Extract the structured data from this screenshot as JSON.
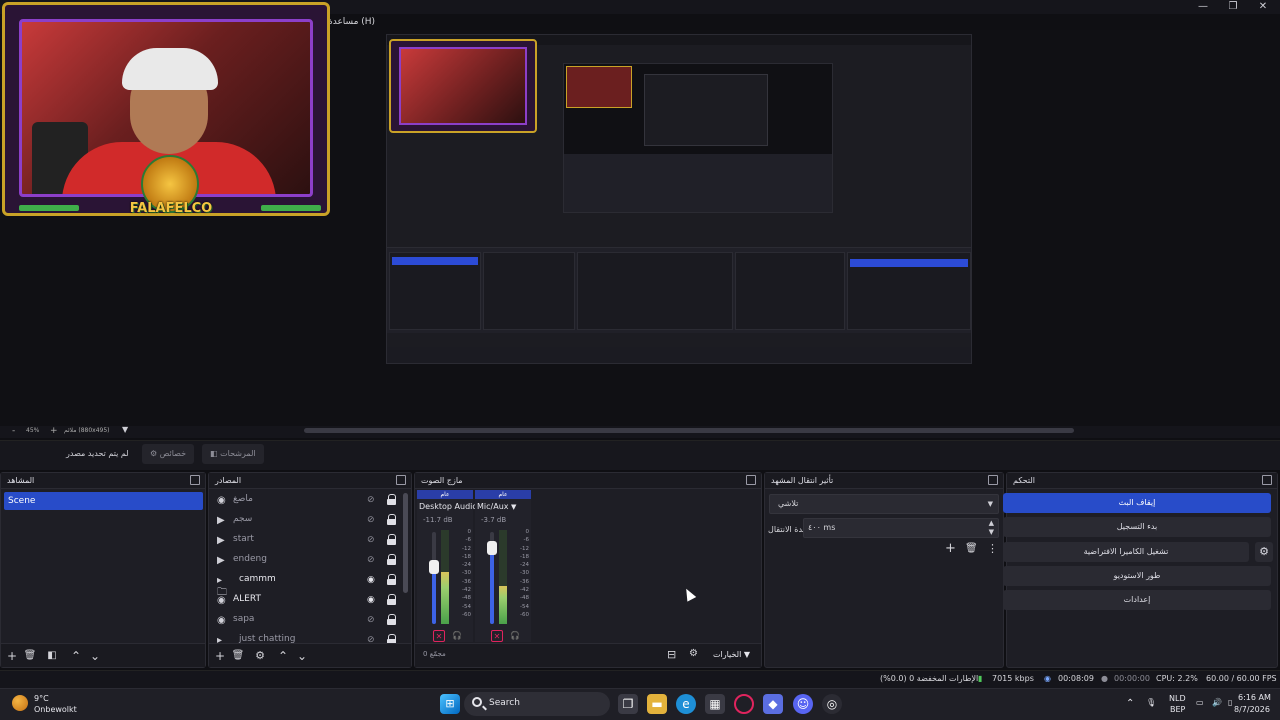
{
  "window": {
    "help_menu": "مساعدة (H)",
    "minimize": "—",
    "maximize": "❐",
    "close": "✕"
  },
  "camera_overlay": {
    "logo_text": "FALAFELCO"
  },
  "preview_toolbar": {
    "zoom_minus": "-",
    "zoom_level": "45%",
    "zoom_plus": "+",
    "canvas_size": "ملائم (880x495)",
    "zoom_dropdown": "▼"
  },
  "context_bar": {
    "no_source": "لم يتم تحديد مصدر",
    "properties": "خصائص",
    "filters": "المرشحات"
  },
  "docks": {
    "scenes": {
      "title": "المشاهد",
      "items": [
        "Scene"
      ]
    },
    "sources": {
      "title": "المصادر",
      "items": [
        {
          "label": "ماصغ",
          "icon": "◉",
          "active": false,
          "visible": false
        },
        {
          "label": "سجم",
          "icon": "▶",
          "active": false,
          "visible": false
        },
        {
          "label": "start",
          "icon": "▶",
          "active": false,
          "visible": false
        },
        {
          "label": "endeng",
          "icon": "▶",
          "active": false,
          "visible": false
        },
        {
          "label": "cammm",
          "icon": "▸",
          "active": true,
          "visible": true
        },
        {
          "label": "ALERT",
          "icon": "◉",
          "active": true,
          "visible": true
        },
        {
          "label": "sapa",
          "icon": "◉",
          "active": false,
          "visible": false
        },
        {
          "label": "just chatting",
          "icon": "▸",
          "active": false,
          "visible": false
        }
      ]
    },
    "mixer": {
      "title": "مازج الصوت",
      "channels": [
        {
          "header": "عام",
          "name": "Desktop Audio",
          "db": "-11.7 dB",
          "level": 0.62,
          "meter": 0.55
        },
        {
          "header": "عام",
          "name": "Mic/Aux",
          "db": "-3.7 dB",
          "level": 0.83,
          "meter": 0.4
        }
      ],
      "scale": [
        "0",
        "-6",
        "-12",
        "-18",
        "-24",
        "-30",
        "-36",
        "-42",
        "-48",
        "-54",
        "-60"
      ],
      "footer_status": "0 مجمّع",
      "options": "الخيارات"
    },
    "transitions": {
      "title": "تأثير انتقال المشهد",
      "transition": "تلاشي",
      "duration_label": "مدة الانتقال",
      "duration_value": "٤٠٠ ms"
    },
    "controls": {
      "title": "التحكم",
      "buttons": [
        {
          "label": "إيقاف البث",
          "primary": true
        },
        {
          "label": "بدء التسجيل",
          "primary": false
        },
        {
          "label": "تشغيل الكاميرا الافتراضية",
          "primary": false
        },
        {
          "label": "طور الاستوديو",
          "primary": false
        },
        {
          "label": "إعدادات",
          "primary": false
        }
      ]
    }
  },
  "status_bar": {
    "dropped_frames": "الإطارات المخفضة 0 (0.0%)",
    "bitrate": "7015 kbps",
    "stream_time": "00:08:09",
    "record_time": "00:00:00",
    "cpu": "CPU: 2.2%",
    "fps": "60.00 / 60.00 FPS"
  },
  "taskbar": {
    "weather_temp": "9°C",
    "weather_desc": "Onbewolkt",
    "search_placeholder": "Search",
    "lang_top": "NLD",
    "lang_bottom": "BEP",
    "time": "6:16 AM",
    "date": "8/7/2026"
  },
  "colors": {
    "accent": "#284cc9",
    "background": "#1e1e25",
    "frame_gold": "#c9a227",
    "frame_purple": "#8c3fc9"
  }
}
